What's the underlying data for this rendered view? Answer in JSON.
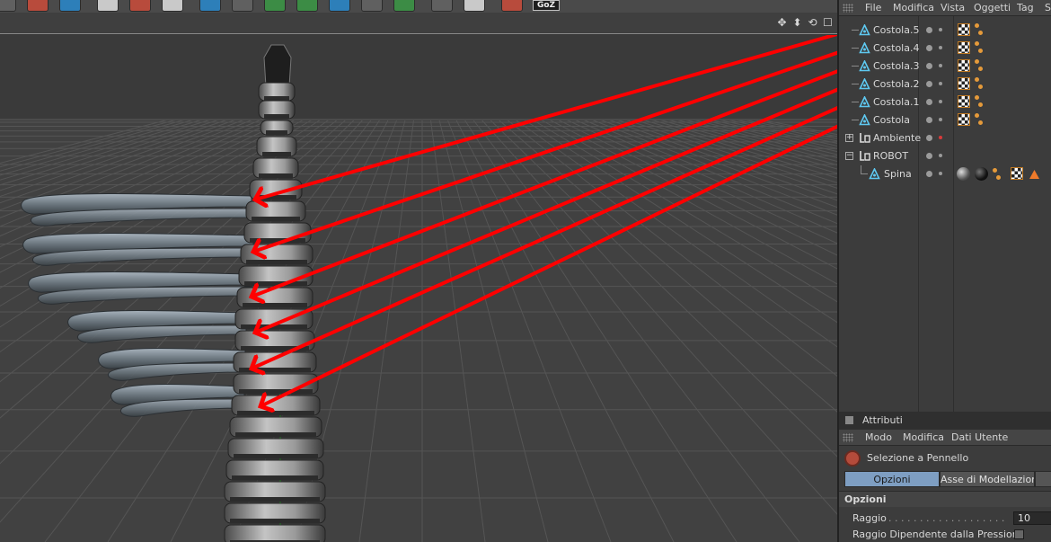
{
  "toolbar": {
    "goz_label": "GoZ"
  },
  "object_manager": {
    "menu": [
      "File",
      "Modifica",
      "Vista",
      "Oggetti",
      "Tag",
      "S"
    ],
    "objects": [
      {
        "name": "Costola.5",
        "type": "bone",
        "tags": [
          "texture",
          "material"
        ]
      },
      {
        "name": "Costola.4",
        "type": "bone",
        "tags": [
          "texture",
          "material"
        ]
      },
      {
        "name": "Costola.3",
        "type": "bone",
        "tags": [
          "texture",
          "material"
        ]
      },
      {
        "name": "Costola.2",
        "type": "bone",
        "tags": [
          "texture",
          "material"
        ]
      },
      {
        "name": "Costola.1",
        "type": "bone",
        "tags": [
          "texture",
          "material"
        ]
      },
      {
        "name": "Costola",
        "type": "bone",
        "tags": [
          "texture",
          "material"
        ]
      },
      {
        "name": "Ambiente",
        "type": "null",
        "tags": []
      },
      {
        "name": "ROBOT",
        "type": "null",
        "tags": []
      },
      {
        "name": "Spina",
        "type": "bone",
        "tags": [
          "sphere-material",
          "black-material",
          "material",
          "texture",
          "phong"
        ]
      }
    ]
  },
  "attributes": {
    "title": "Attributi",
    "menu": [
      "Modo",
      "Modifica",
      "Dati Utente"
    ],
    "tool_name": "Selezione a Pennello",
    "tabs": [
      "Opzioni",
      "Asse di Modellazione"
    ],
    "section": "Opzioni",
    "fields": [
      {
        "label": "Raggio",
        "value": "10"
      },
      {
        "label": "Raggio Dipendente dalla Pressione",
        "value": ""
      }
    ]
  },
  "colors": {
    "arrow": "#ff0000",
    "accent_tab": "#7e9ec2",
    "bone_icon": "#5ec8f0"
  }
}
